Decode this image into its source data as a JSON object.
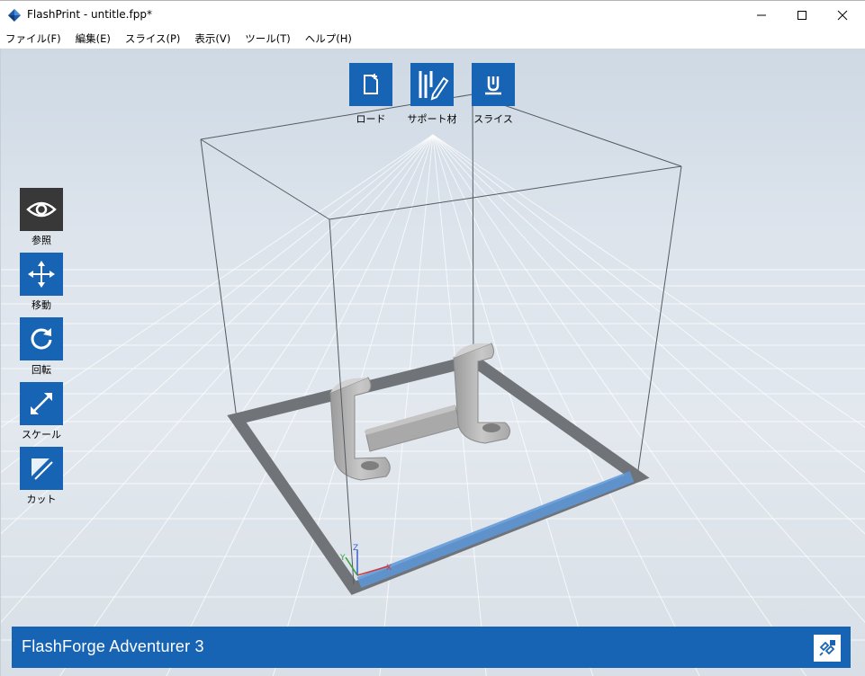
{
  "window": {
    "title": "FlashPrint - untitle.fpp*",
    "app_icon": "flashprint-diamond-icon",
    "controls": [
      "minimize-icon",
      "maximize-icon",
      "close-icon"
    ]
  },
  "menu": [
    {
      "label": "ファイル(F)"
    },
    {
      "label": "編集(E)"
    },
    {
      "label": "スライス(P)"
    },
    {
      "label": "表示(V)"
    },
    {
      "label": "ツール(T)"
    },
    {
      "label": "ヘルプ(H)"
    }
  ],
  "top_toolbar": [
    {
      "label": "ロード",
      "icon": "load-file-icon"
    },
    {
      "label": "サポート材",
      "icon": "support-icon"
    },
    {
      "label": "スライス",
      "icon": "slice-icon"
    }
  ],
  "side_toolbar": [
    {
      "label": "参照",
      "icon": "eye-icon",
      "active": true
    },
    {
      "label": "移動",
      "icon": "move-icon"
    },
    {
      "label": "回転",
      "icon": "rotate-icon"
    },
    {
      "label": "スケール",
      "icon": "scale-icon"
    },
    {
      "label": "カット",
      "icon": "cut-icon"
    }
  ],
  "axes": {
    "x": "X",
    "y": "Y",
    "z": "Z"
  },
  "status": {
    "printer": "FlashForge Adventurer 3",
    "connect_icon": "connect-printer-icon"
  },
  "colors": {
    "accent": "#1764b5",
    "active_tool": "#383838",
    "model": "#b9b9b9",
    "bed_border": "#707478",
    "bed_front_edge": "#5c97d8"
  }
}
